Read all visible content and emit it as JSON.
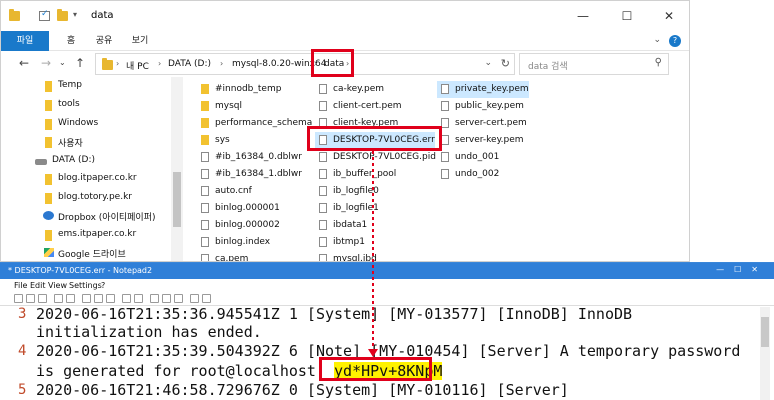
{
  "explorer": {
    "title": "data",
    "ribbon": {
      "tabs": [
        "파일",
        "홈",
        "공유",
        "보기"
      ]
    },
    "breadcrumb": [
      "내 PC",
      "DATA (D:)",
      "mysql-8.0.20-winx64",
      "data"
    ],
    "search_placeholder": "data 검색",
    "nav_items": [
      {
        "label": "Temp",
        "icon": "folder-icon"
      },
      {
        "label": "tools",
        "icon": "folder-icon"
      },
      {
        "label": "Windows",
        "icon": "folder-icon"
      },
      {
        "label": "사용자",
        "icon": "folder-icon"
      },
      {
        "label": "DATA (D:)",
        "icon": "drive-icon"
      },
      {
        "label": "blog.itpaper.co.kr",
        "icon": "folder-icon"
      },
      {
        "label": "blog.totory.pe.kr",
        "icon": "folder-icon"
      },
      {
        "label": "Dropbox (아이티페이퍼)",
        "icon": "dropbox-icon"
      },
      {
        "label": "ems.itpaper.co.kr",
        "icon": "folder-icon"
      },
      {
        "label": "Google 드라이브",
        "icon": "google-drive-icon"
      }
    ],
    "files": {
      "col1": [
        {
          "name": "#innodb_temp",
          "type": "folder"
        },
        {
          "name": "mysql",
          "type": "folder"
        },
        {
          "name": "performance_schema",
          "type": "folder"
        },
        {
          "name": "sys",
          "type": "folder"
        },
        {
          "name": "#ib_16384_0.dblwr",
          "type": "file"
        },
        {
          "name": "#ib_16384_1.dblwr",
          "type": "file"
        },
        {
          "name": "auto.cnf",
          "type": "file"
        },
        {
          "name": "binlog.000001",
          "type": "file"
        },
        {
          "name": "binlog.000002",
          "type": "file"
        },
        {
          "name": "binlog.index",
          "type": "file"
        },
        {
          "name": "ca.pem",
          "type": "file"
        }
      ],
      "col2": [
        {
          "name": "ca-key.pem",
          "type": "file"
        },
        {
          "name": "client-cert.pem",
          "type": "file"
        },
        {
          "name": "client-key.pem",
          "type": "file"
        },
        {
          "name": "DESKTOP-7VL0CEG.err",
          "type": "file"
        },
        {
          "name": "DESKTOP-7VL0CEG.pid",
          "type": "file"
        },
        {
          "name": "ib_buffer_pool",
          "type": "file"
        },
        {
          "name": "ib_logfile0",
          "type": "file"
        },
        {
          "name": "ib_logfile1",
          "type": "file"
        },
        {
          "name": "ibdata1",
          "type": "file"
        },
        {
          "name": "ibtmp1",
          "type": "file"
        },
        {
          "name": "mysql.ibd",
          "type": "file"
        }
      ],
      "col3": [
        {
          "name": "private_key.pem",
          "type": "file"
        },
        {
          "name": "public_key.pem",
          "type": "file"
        },
        {
          "name": "server-cert.pem",
          "type": "file"
        },
        {
          "name": "server-key.pem",
          "type": "file"
        },
        {
          "name": "undo_001",
          "type": "file"
        },
        {
          "name": "undo_002",
          "type": "file"
        }
      ]
    }
  },
  "notepad": {
    "title": "* DESKTOP-7VL0CEG.err - Notepad2",
    "menu": [
      "File",
      "Edit",
      "View",
      "Settings",
      "?"
    ],
    "lines": [
      {
        "num": "3",
        "text": "2020-06-16T21:35:36.945541Z 1 [System] [MY-013577] [InnoDB] InnoDB"
      },
      {
        "num": "",
        "text": "initialization has ended."
      },
      {
        "num": "4",
        "text": "2020-06-16T21:35:39.504392Z 6 [Note] [MY-010454] [Server] A temporary password"
      },
      {
        "num": "",
        "text_prefix": "is generated for root@localhost: ",
        "password": "yd*HPv+8KNpM"
      },
      {
        "num": "5",
        "text": "2020-06-16T21:46:58.729676Z 0 [System] [MY-010116] [Server]"
      }
    ]
  },
  "colors": {
    "highlight_red": "#e0001b",
    "accent_blue": "#1979ca",
    "password_highlight": "#fff200"
  }
}
